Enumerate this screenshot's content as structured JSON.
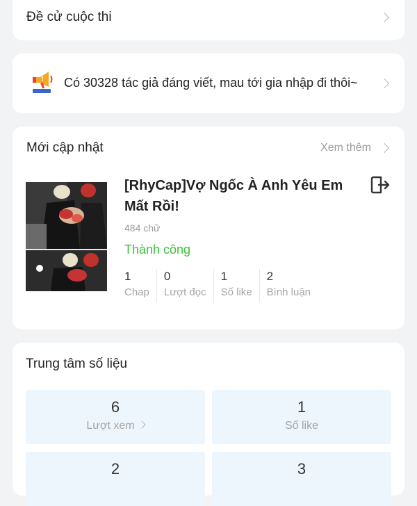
{
  "contest": {
    "label": "Đề cử cuộc thi"
  },
  "promo": {
    "text": "Có 30328 tác giả đáng viết, mau tới gia nhập đi thôi~"
  },
  "recent": {
    "title": "Mới cập nhật",
    "more_label": "Xem thêm",
    "work": {
      "title": "[RhyCap]Vợ Ngốc À Anh Yêu Em Mất Rồi!",
      "word_count": "484 chữ",
      "status": "Thành công",
      "stats": [
        {
          "value": "1",
          "label": "Chap"
        },
        {
          "value": "0",
          "label": "Lượt đọc"
        },
        {
          "value": "1",
          "label": "Số like"
        },
        {
          "value": "2",
          "label": "Bình luận"
        }
      ]
    }
  },
  "data_center": {
    "title": "Trung tâm số liệu",
    "tiles": [
      {
        "value": "6",
        "label": "Lượt xem"
      },
      {
        "value": "1",
        "label": "Số like"
      },
      {
        "value": "2",
        "label": ""
      },
      {
        "value": "3",
        "label": ""
      }
    ]
  },
  "colors": {
    "success": "#3cc23c",
    "tile_bg": "#edf5fd",
    "page_bg": "#f2f3f5"
  }
}
